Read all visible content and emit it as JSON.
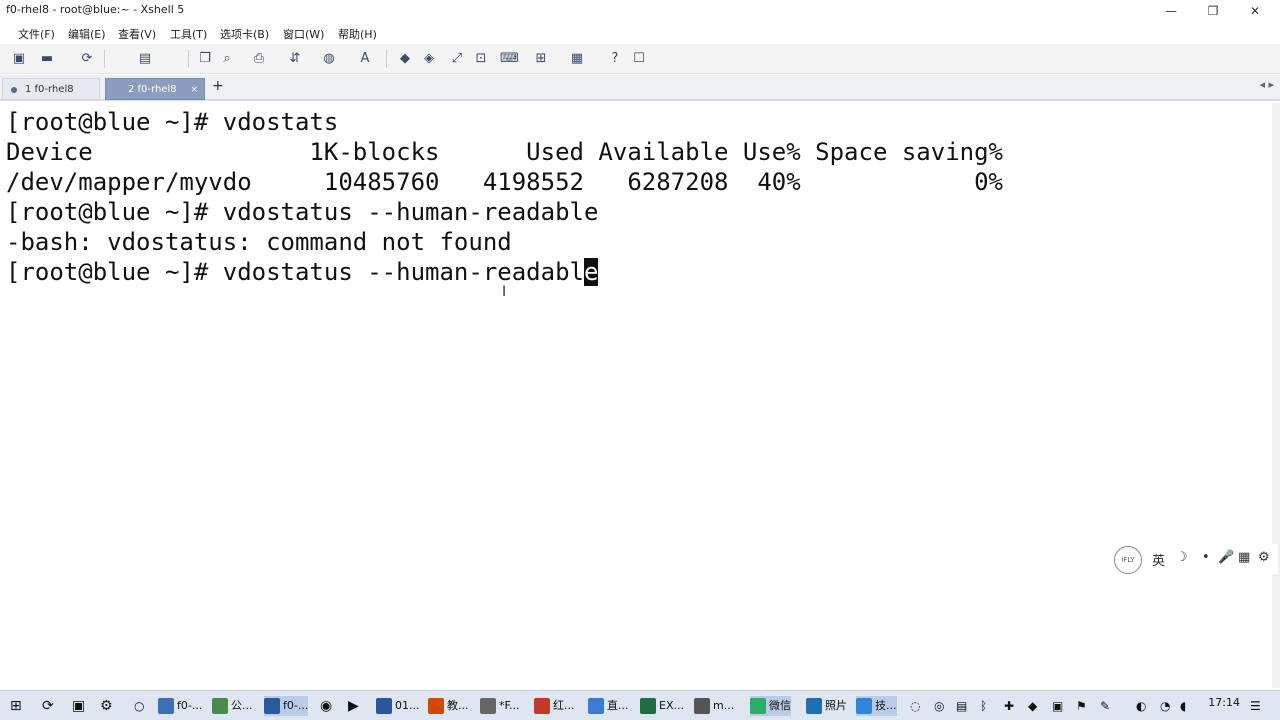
{
  "window": {
    "title": "f0-rhel8 - root@blue:~ - Xshell 5",
    "minimize": "—",
    "restore": "❐",
    "close": "✕"
  },
  "menu": [
    "文件(F)",
    "编辑(E)",
    "查看(V)",
    "工具(T)",
    "选项卡(B)",
    "窗口(W)",
    "帮助(H)"
  ],
  "toolbar_icons": [
    "new-session-icon",
    "open-folder-icon",
    "reconnect-icon",
    "properties-icon",
    "copy-icon",
    "find-icon",
    "print-icon",
    "transfer-icon",
    "globe-icon",
    "font-icon",
    "xftp-icon",
    "xmanager-icon",
    "fullscreen-icon",
    "lock-icon",
    "keyboard-icon",
    "compose-icon",
    "layout-icon",
    "help-icon",
    "chat-icon"
  ],
  "tabs": [
    {
      "label": "1 f0-rhel8",
      "active": false
    },
    {
      "label": "2 f0-rhel8",
      "active": true
    }
  ],
  "tab_add": "+",
  "tab_nav": "◂ ▸",
  "terminal": {
    "lines": [
      "[root@blue ~]# vdostats",
      "Device               1K-blocks      Used Available Use% Space saving%",
      "/dev/mapper/myvdo     10485760   4198552   6287208  40%            0%",
      "[root@blue ~]# vdostatus --human-readable",
      "-bash: vdostatus: command not found",
      "[root@blue ~]# vdostatus --human-readabl"
    ],
    "cursor_char": "e"
  },
  "ime": {
    "logo": "iFLY",
    "items": [
      "英",
      "☽",
      "•",
      "🎤",
      "▦",
      "⚙"
    ]
  },
  "taskbar": {
    "items": [
      "f0-...",
      "公...",
      "f0-...",
      "01...",
      "教...",
      "*F...",
      "红...",
      "直...",
      "EX...",
      "m...",
      "微信",
      "照片",
      "技..."
    ],
    "clock": "17:14"
  },
  "colors": {
    "active_tab": "#8a9cc0",
    "terminal_bg": "#ffffff",
    "terminal_fg": "#111111",
    "taskbar": "#dde6f1"
  }
}
